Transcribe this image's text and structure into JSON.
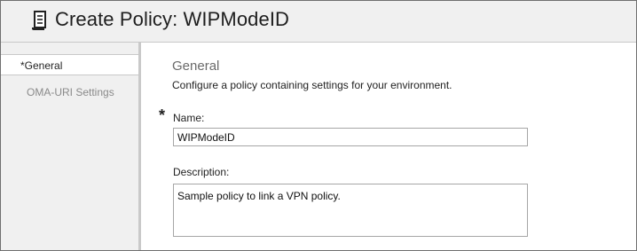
{
  "header": {
    "icon": "policy-scroll-icon",
    "title": "Create Policy: WIPModeID"
  },
  "sidebar": {
    "items": [
      {
        "label": "*General",
        "active": true
      },
      {
        "label": "OMA-URI Settings",
        "active": false
      }
    ]
  },
  "main": {
    "section_title": "General",
    "section_description": "Configure a policy containing settings for your environment.",
    "required_marker": "*",
    "name_label": "Name:",
    "name_value": "WIPModeID",
    "description_label": "Description:",
    "description_value": "Sample policy to link a VPN policy."
  }
}
